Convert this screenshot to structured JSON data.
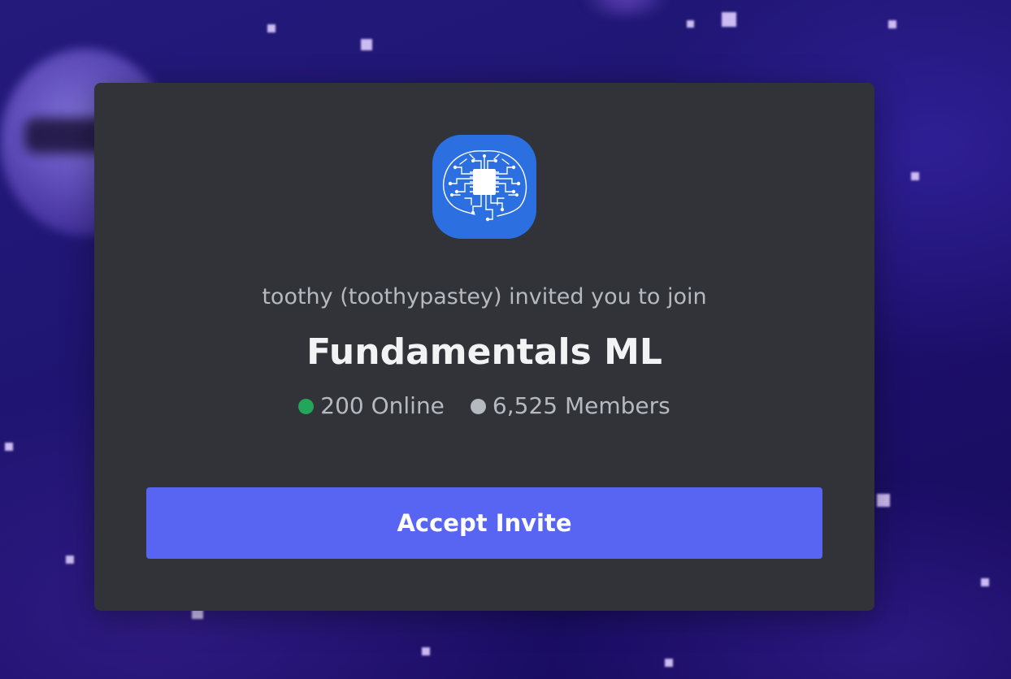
{
  "invite": {
    "inviter_text": "toothy (toothypastey) invited you to join",
    "server_name": "Fundamentals ML",
    "online_count": "200 Online",
    "member_count": "6,525 Members",
    "accept_label": "Accept Invite",
    "server_icon": "brain-chip-circuit-icon"
  },
  "colors": {
    "modal_bg": "#313338",
    "accent": "#5865f2",
    "online": "#23a55a",
    "members": "#b5bac1",
    "icon_bg": "#2b6fe0"
  }
}
